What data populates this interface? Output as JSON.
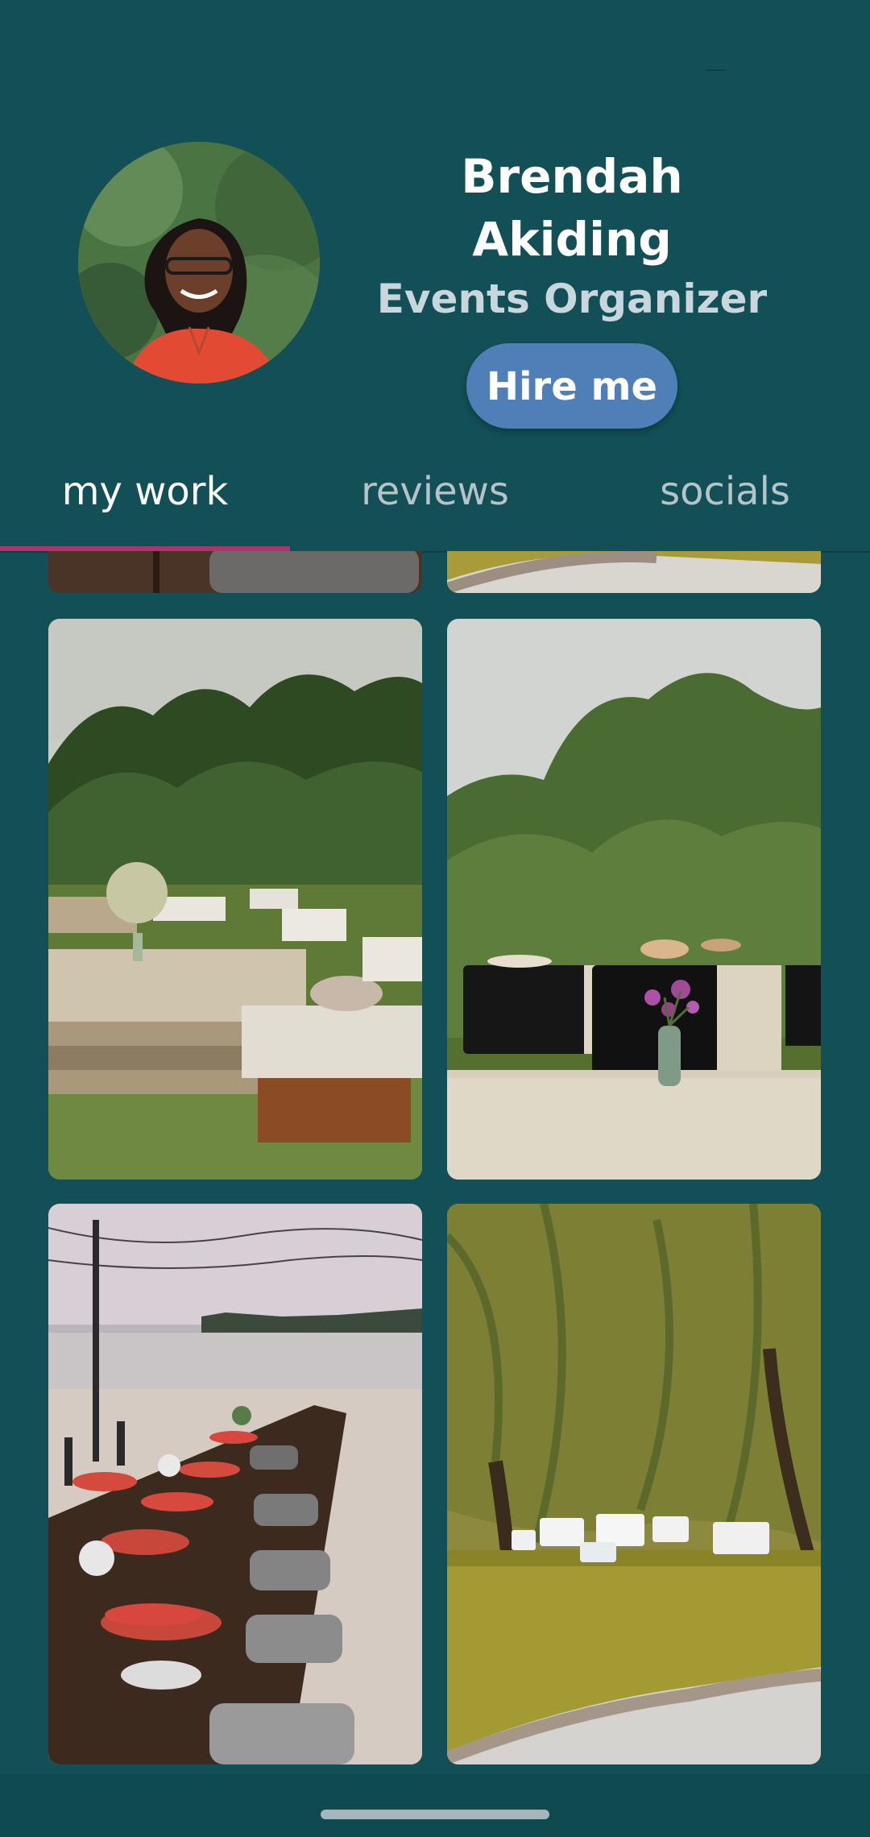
{
  "profile": {
    "name": "Brendah Akiding",
    "role": "Events Organizer",
    "hire_label": "Hire me"
  },
  "tabs": [
    {
      "label": "my work",
      "active": true
    },
    {
      "label": "reviews",
      "active": false
    },
    {
      "label": "socials",
      "active": false
    }
  ],
  "colors": {
    "background": "#124f56",
    "accent_button": "#4f7fb6",
    "tab_indicator": "#b0326f",
    "role_text": "#c9d6dc"
  },
  "gallery": {
    "photos": [
      {
        "name": "photo-long-dining-table-partial"
      },
      {
        "name": "photo-garden-lawn-partial"
      },
      {
        "name": "photo-pallet-lounge-garden"
      },
      {
        "name": "photo-buffet-tables-flowers"
      },
      {
        "name": "photo-beach-dinner-table"
      },
      {
        "name": "photo-willow-lawn-tables"
      }
    ]
  }
}
